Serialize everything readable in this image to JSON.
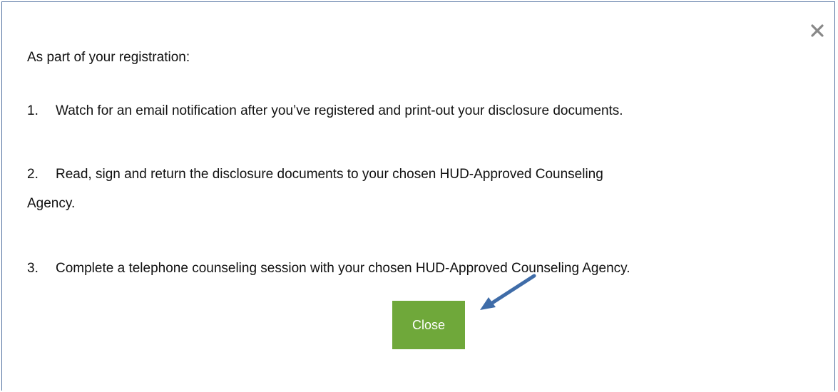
{
  "modal": {
    "intro": "As part of your registration:",
    "steps": [
      {
        "number": "1.",
        "text": "Watch for an email notification after you’ve registered and print-out your disclosure documents."
      },
      {
        "number": "2.",
        "text": "Read, sign and return the disclosure documents to your chosen HUD-Approved Counseling",
        "continuation": "Agency."
      },
      {
        "number": "3.",
        "text": "Complete a telephone counseling session with your chosen HUD-Approved Counseling Agency."
      }
    ],
    "close_button_label": "Close",
    "close_icon": "close-icon",
    "annotation_arrow_icon": "arrow-icon",
    "colors": {
      "border": "#4f6f9f",
      "button": "#6fa83a",
      "arrow": "#3f6ca8",
      "close_x": "#888888"
    }
  }
}
